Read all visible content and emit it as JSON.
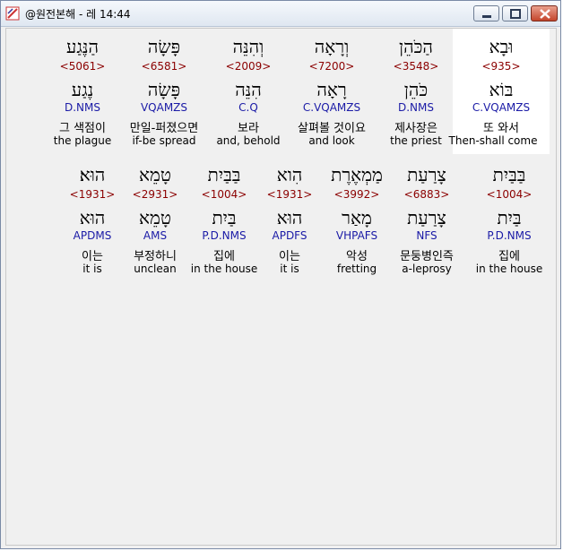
{
  "window": {
    "title": "@원전본해 - 레 14:44"
  },
  "rows": [
    [
      {
        "heb": "וּבָא",
        "strong": "<935>",
        "lemma": "בּוֹא",
        "morph": "C.VQAMZS",
        "kor": "또 와서",
        "eng": "Then-shall come",
        "highlight": true
      },
      {
        "heb": "הַכֹּהֵן",
        "strong": "<3548>",
        "lemma": "כֹּהֵן",
        "morph": "D.NMS",
        "kor": "제사장은",
        "eng": "the priest"
      },
      {
        "heb": "וְרָאָה",
        "strong": "<7200>",
        "lemma": "רָאָה",
        "morph": "C.VQAMZS",
        "kor": "살펴볼 것이요",
        "eng": "and look"
      },
      {
        "heb": "וְהִנֵּה",
        "strong": "<2009>",
        "lemma": "הִנֵּה",
        "morph": "C.Q",
        "kor": "보라",
        "eng": "and, behold"
      },
      {
        "heb": "פָּשָׂה",
        "strong": "<6581>",
        "lemma": "פָּשָׂה",
        "morph": "VQAMZS",
        "kor": "만일-퍼졌으면",
        "eng": "if-be spread"
      },
      {
        "heb": "הַנֶּגַע",
        "strong": "<5061>",
        "lemma": "נֶגַע",
        "morph": "D.NMS",
        "kor": "그 색점이",
        "eng": "the plague"
      }
    ],
    [
      {
        "heb": "בַּבַּיִת",
        "strong": "<1004>",
        "lemma": "בַּיִת",
        "morph": "P.D.NMS",
        "kor": "집에",
        "eng": "in the house"
      },
      {
        "heb": "צָרַעַת",
        "strong": "<6883>",
        "lemma": "צָרַעַת",
        "morph": "NFS",
        "kor": "문둥병인즉",
        "eng": "a-leprosy"
      },
      {
        "heb": "מַמְאֶרֶת",
        "strong": "<3992>",
        "lemma": "מָאַר",
        "morph": "VHPAFS",
        "kor": "악성",
        "eng": "fretting"
      },
      {
        "heb": "הִוא",
        "strong": "<1931>",
        "lemma": "הוּא",
        "morph": "APDFS",
        "kor": "이는",
        "eng": "it is"
      },
      {
        "heb": "בַּבַּיִת",
        "strong": "<1004>",
        "lemma": "בַּיִת",
        "morph": "P.D.NMS",
        "kor": "집에",
        "eng": "in the house"
      },
      {
        "heb": "טָמֵא",
        "strong": "<2931>",
        "lemma": "טָמֵא",
        "morph": "AMS",
        "kor": "부정하니",
        "eng": "unclean"
      },
      {
        "heb": "הוּא׃",
        "strong": "<1931>",
        "lemma": "הוּא",
        "morph": "APDMS",
        "kor": "이는",
        "eng": "it is"
      }
    ]
  ]
}
